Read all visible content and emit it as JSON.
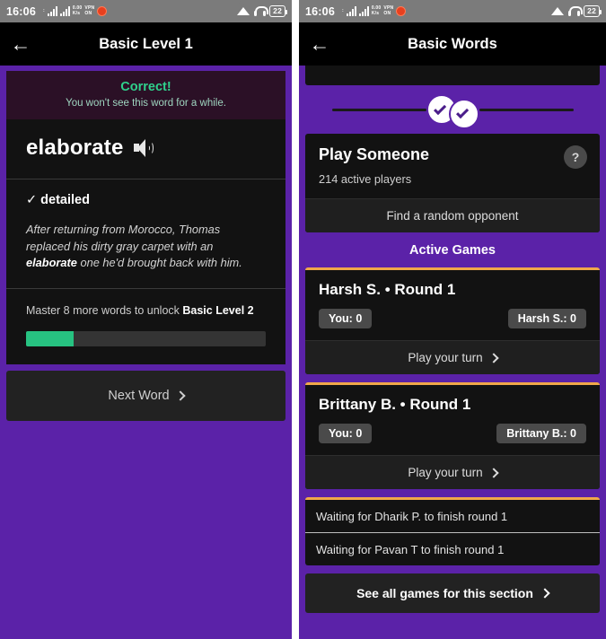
{
  "status_bar": {
    "time": "16:06",
    "battery_level": "22",
    "icons": [
      "signal-bars-icon",
      "signal-bars-icon",
      "data-rate-icon",
      "vpn-icon",
      "reddit-notification-icon",
      "wifi-off-icon",
      "headset-icon",
      "battery-icon"
    ]
  },
  "left_screen": {
    "title": "Basic Level 1",
    "back_label": "←",
    "banner": {
      "title": "Correct!",
      "subtitle": "You won't see this word for a while."
    },
    "word": "elaborate",
    "definition": "detailed",
    "check_mark": "✓",
    "sentence_part1": "After returning from Morocco, Thomas replaced his dirty gray carpet with an ",
    "sentence_word": "elaborate",
    "sentence_part2": " one he'd brought back with him.",
    "master_text_pre": "Master 8 more words to unlock ",
    "master_text_bold": "Basic Level 2",
    "progress_percent": 20,
    "next_word_label": "Next Word"
  },
  "right_screen": {
    "title": "Basic Words",
    "back_label": "←",
    "progress_badges": 2,
    "play_someone": {
      "title": "Play Someone",
      "active_players": "214 active players",
      "help_label": "?",
      "action_label": "Find a random opponent"
    },
    "active_games_header": "Active Games",
    "games": [
      {
        "title": "Harsh S. • Round 1",
        "your_score": "You: 0",
        "opponent_score": "Harsh S.: 0",
        "action_label": "Play your turn"
      },
      {
        "title": "Brittany B. • Round 1",
        "your_score": "You: 0",
        "opponent_score": "Brittany B.: 0",
        "action_label": "Play your turn"
      }
    ],
    "waiting": [
      "Waiting for Dharik P. to finish round 1",
      "Waiting for Pavan T to finish round 1"
    ],
    "see_all_label": "See all games for this section"
  },
  "colors": {
    "purple_bg": "#5b22a8",
    "card_bg": "#121212",
    "accent_green": "#27c281",
    "accent_orange": "#f0a84a",
    "banner_bg": "#2b1026"
  }
}
